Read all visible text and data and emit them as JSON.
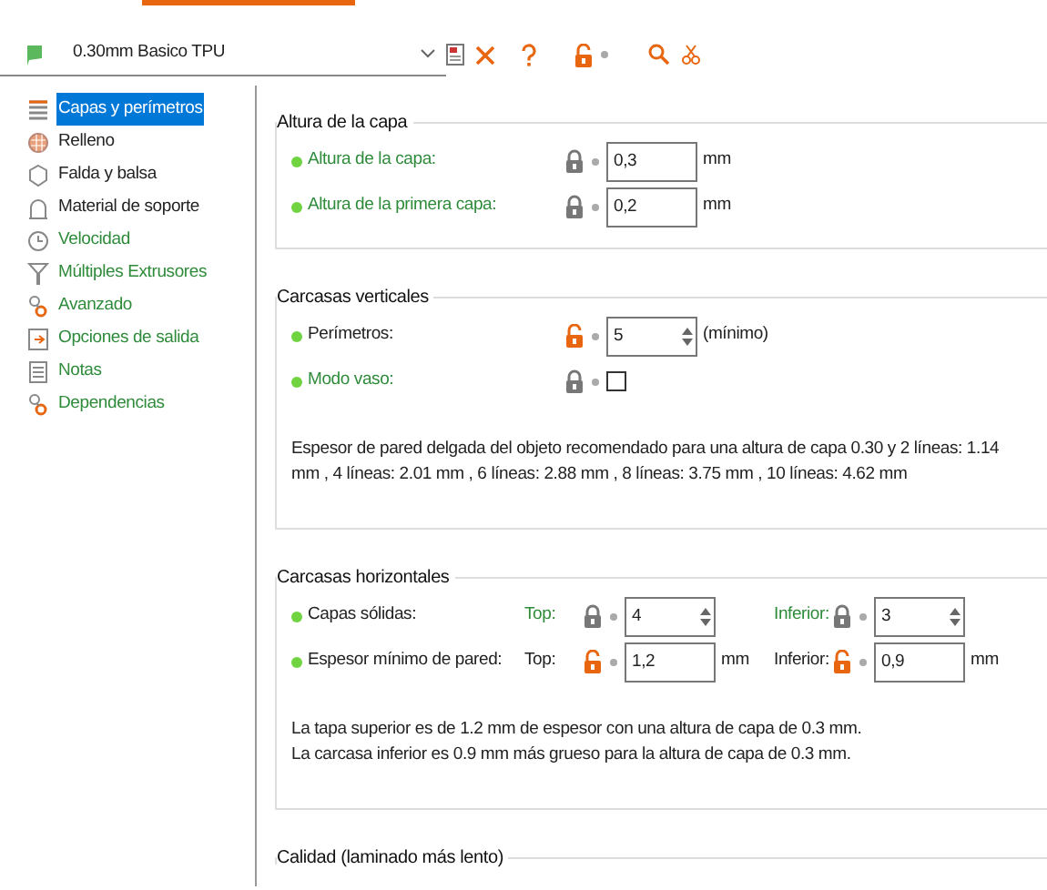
{
  "toolbar": {
    "preset": "0.30mm Basico TPU",
    "locked": false
  },
  "sidebar": {
    "items": [
      {
        "label": "Capas y perímetros",
        "selected": true,
        "system_value": false
      },
      {
        "label": "Relleno",
        "selected": false,
        "system_value": false
      },
      {
        "label": "Falda y balsa",
        "selected": false,
        "system_value": false
      },
      {
        "label": "Material de soporte",
        "selected": false,
        "system_value": false
      },
      {
        "label": "Velocidad",
        "selected": false,
        "system_value": true
      },
      {
        "label": "Múltiples Extrusores",
        "selected": false,
        "system_value": true
      },
      {
        "label": "Avanzado",
        "selected": false,
        "system_value": true
      },
      {
        "label": "Opciones de salida",
        "selected": false,
        "system_value": true
      },
      {
        "label": "Notas",
        "selected": false,
        "system_value": true
      },
      {
        "label": "Dependencias",
        "selected": false,
        "system_value": true
      }
    ]
  },
  "sections": [
    {
      "title": "Altura de la capa",
      "rows": [
        {
          "kind": "number",
          "label": "Altura de la capa:",
          "system_value": true,
          "locked": true,
          "value": "0,3",
          "unit": "mm"
        },
        {
          "kind": "number",
          "label": "Altura de la primera capa:",
          "system_value": true,
          "locked": true,
          "value": "0,2",
          "unit": "mm"
        }
      ]
    },
    {
      "title": "Carcasas verticales",
      "rows": [
        {
          "kind": "spin",
          "label": "Perímetros:",
          "system_value": false,
          "locked": false,
          "value": "5",
          "unit": "(mínimo)"
        },
        {
          "kind": "checkbox",
          "label": "Modo vaso:",
          "system_value": true,
          "locked": true,
          "checked": false
        }
      ],
      "notes": [
        "Espesor de pared delgada del objeto recomendado para una altura de capa 0.30 y 2 líneas: 1.14 mm , 4 líneas: 2.01 mm , 6 líneas: 2.88 mm , 8 líneas: 3.75 mm , 10 líneas: 4.62 mm"
      ]
    },
    {
      "title": "Carcasas horizontales",
      "rows": [
        {
          "kind": "pair",
          "label": "Capas sólidas:",
          "system_value": false,
          "parts": [
            {
              "kind": "spin",
              "label": "Top:",
              "system_value": true,
              "locked": true,
              "value": "4"
            },
            {
              "kind": "spin",
              "label": "Inferior:",
              "system_value": true,
              "locked": true,
              "value": "3"
            }
          ]
        },
        {
          "kind": "pair",
          "label": "Espesor mínimo de pared:",
          "system_value": false,
          "parts": [
            {
              "kind": "number",
              "label": "Top:",
              "system_value": false,
              "locked": false,
              "value": "1,2",
              "unit": "mm"
            },
            {
              "kind": "number",
              "label": "Inferior:",
              "system_value": false,
              "locked": false,
              "value": "0,9",
              "unit": "mm"
            }
          ]
        }
      ],
      "notes": [
        "La tapa superior es de 1.2 mm de espesor con una altura de capa de 0.3 mm.",
        "La carcasa inferior es 0.9 mm más grueso para la altura de capa de 0.3 mm."
      ]
    },
    {
      "title": "Calidad (laminado más lento)"
    }
  ]
}
